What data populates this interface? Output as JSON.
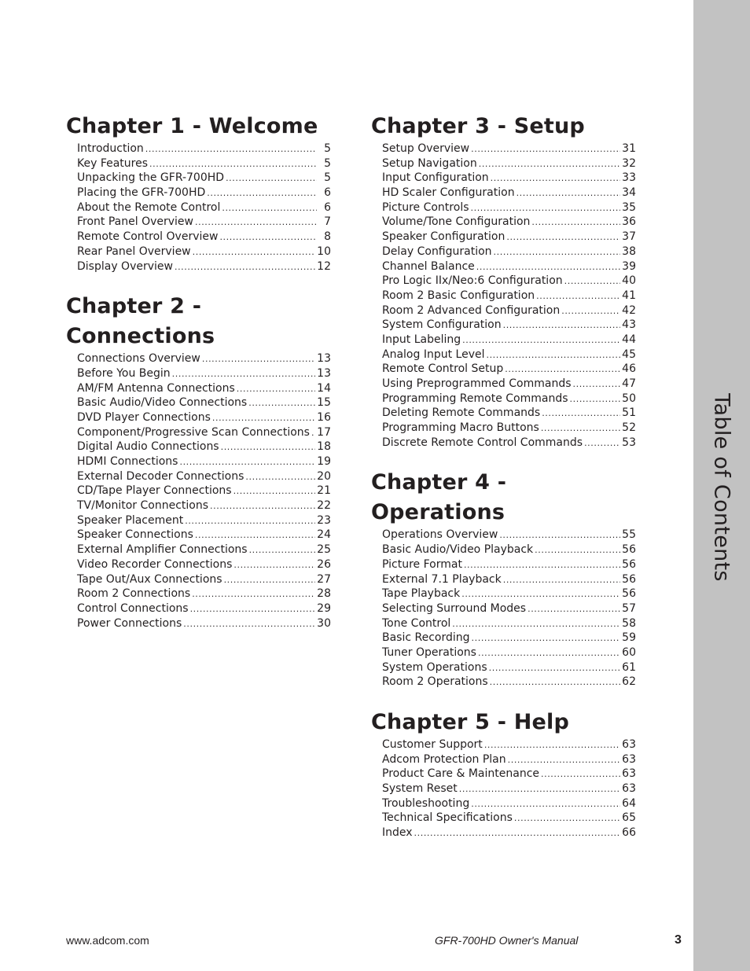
{
  "side_tab": {
    "label": "Table of Contents",
    "color": "#c2c2c2"
  },
  "chapters": [
    {
      "title": "Chapter 1 - Welcome",
      "entries": [
        {
          "label": "Introduction",
          "page": "5"
        },
        {
          "label": "Key Features",
          "page": "5"
        },
        {
          "label": "Unpacking the GFR-700HD",
          "page": "5"
        },
        {
          "label": "Placing the GFR-700HD",
          "page": "6"
        },
        {
          "label": "About the Remote Control",
          "page": "6"
        },
        {
          "label": "Front Panel Overview",
          "page": "7"
        },
        {
          "label": "Remote Control Overview",
          "page": "8"
        },
        {
          "label": "Rear Panel Overview",
          "page": "10"
        },
        {
          "label": "Display Overview",
          "page": "12"
        }
      ]
    },
    {
      "title": "Chapter 2 - Connections",
      "entries": [
        {
          "label": "Connections Overview",
          "page": "13"
        },
        {
          "label": "Before You Begin",
          "page": "13"
        },
        {
          "label": "AM/FM Antenna Connections",
          "page": "14"
        },
        {
          "label": "Basic Audio/Video Connections",
          "page": "15"
        },
        {
          "label": "DVD Player Connections",
          "page": "16"
        },
        {
          "label": "Component/Progressive Scan Connections",
          "page": "17"
        },
        {
          "label": "Digital Audio Connections",
          "page": "18"
        },
        {
          "label": "HDMI Connections",
          "page": "19"
        },
        {
          "label": "External Decoder Connections",
          "page": "20"
        },
        {
          "label": "CD/Tape Player Connections",
          "page": "21"
        },
        {
          "label": "TV/Monitor Connections",
          "page": "22"
        },
        {
          "label": "Speaker Placement",
          "page": "23"
        },
        {
          "label": "Speaker Connections",
          "page": "24"
        },
        {
          "label": "External Amplifier Connections",
          "page": "25"
        },
        {
          "label": "Video Recorder Connections",
          "page": "26"
        },
        {
          "label": "Tape Out/Aux Connections",
          "page": "27"
        },
        {
          "label": "Room 2 Connections",
          "page": "28"
        },
        {
          "label": "Control Connections",
          "page": "29"
        },
        {
          "label": "Power Connections",
          "page": "30"
        }
      ]
    },
    {
      "title": "Chapter 3 - Setup",
      "entries": [
        {
          "label": "Setup Overview",
          "page": "31"
        },
        {
          "label": "Setup Navigation",
          "page": "32"
        },
        {
          "label": "Input Configuration",
          "page": "33"
        },
        {
          "label": "HD Scaler Configuration",
          "page": "34"
        },
        {
          "label": "Picture Controls",
          "page": "35"
        },
        {
          "label": "Volume/Tone Configuration",
          "page": "36"
        },
        {
          "label": "Speaker Configuration",
          "page": "37"
        },
        {
          "label": "Delay Configuration",
          "page": "38"
        },
        {
          "label": "Channel Balance",
          "page": "39"
        },
        {
          "label": "Pro Logic IIx/Neo:6 Configuration",
          "page": "40"
        },
        {
          "label": "Room 2 Basic Configuration",
          "page": "41"
        },
        {
          "label": "Room 2 Advanced Configuration",
          "page": "42"
        },
        {
          "label": "System Configuration",
          "page": "43"
        },
        {
          "label": "Input Labeling",
          "page": "44"
        },
        {
          "label": "Analog Input Level",
          "page": "45"
        },
        {
          "label": "Remote Control Setup",
          "page": "46"
        },
        {
          "label": "Using Preprogrammed Commands",
          "page": "47"
        },
        {
          "label": "Programming Remote Commands",
          "page": "50"
        },
        {
          "label": "Deleting Remote Commands",
          "page": "51"
        },
        {
          "label": "Programming Macro Buttons",
          "page": "52"
        },
        {
          "label": "Discrete Remote Control Commands",
          "page": "53"
        }
      ]
    },
    {
      "title": "Chapter 4 - Operations",
      "entries": [
        {
          "label": "Operations Overview",
          "page": "55"
        },
        {
          "label": "Basic Audio/Video Playback",
          "page": "56"
        },
        {
          "label": "Picture Format",
          "page": "56"
        },
        {
          "label": "External 7.1 Playback",
          "page": "56"
        },
        {
          "label": "Tape Playback",
          "page": "56"
        },
        {
          "label": "Selecting Surround Modes",
          "page": "57"
        },
        {
          "label": "Tone Control",
          "page": "58"
        },
        {
          "label": "Basic Recording",
          "page": "59"
        },
        {
          "label": "Tuner Operations",
          "page": "60"
        },
        {
          "label": "System Operations",
          "page": "61"
        },
        {
          "label": "Room 2 Operations",
          "page": "62"
        }
      ]
    },
    {
      "title": "Chapter 5 - Help",
      "entries": [
        {
          "label": "Customer Support",
          "page": "63"
        },
        {
          "label": "Adcom Protection Plan",
          "page": "63"
        },
        {
          "label": "Product Care & Maintenance",
          "page": "63"
        },
        {
          "label": "System Reset",
          "page": "63"
        },
        {
          "label": "Troubleshooting",
          "page": "64"
        },
        {
          "label": "Technical Specifications",
          "page": "65"
        },
        {
          "label": "Index",
          "page": "66"
        }
      ]
    }
  ],
  "footer": {
    "url": "www.adcom.com",
    "manual_title": "GFR-700HD Owner's Manual",
    "page_number": "3"
  }
}
